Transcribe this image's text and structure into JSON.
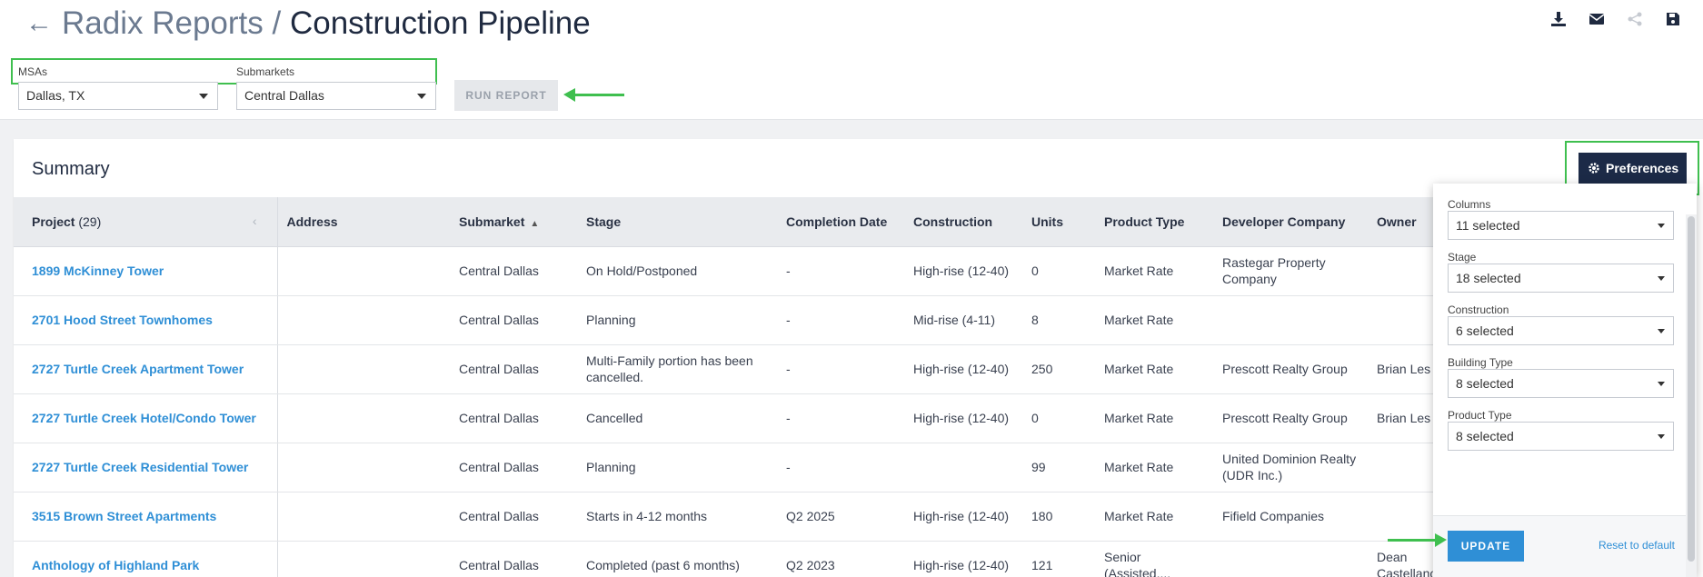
{
  "header": {
    "crumb": "Radix Reports",
    "separator": " / ",
    "title": "Construction Pipeline",
    "icons": [
      "download-icon",
      "email-icon",
      "share-icon",
      "save-icon"
    ]
  },
  "filters": {
    "msa_label": "MSAs",
    "msa_value": "Dallas, TX",
    "submarket_label": "Submarkets",
    "submarket_value": "Central Dallas",
    "run_label": "RUN REPORT"
  },
  "summary": {
    "title": "Summary",
    "preferences_label": "Preferences",
    "columns": [
      {
        "label": "Project",
        "count": "(29)"
      },
      {
        "label": "Address"
      },
      {
        "label": "Submarket"
      },
      {
        "label": "Stage"
      },
      {
        "label": "Completion Date"
      },
      {
        "label": "Construction"
      },
      {
        "label": "Units"
      },
      {
        "label": "Product Type"
      },
      {
        "label": "Developer Company"
      },
      {
        "label": "Owner"
      }
    ],
    "rows": [
      {
        "project": "1899 McKinney Tower",
        "address": "",
        "submarket": "Central Dallas",
        "stage": "On Hold/Postponed",
        "completion": "-",
        "construction": "High-rise (12-40)",
        "units": "0",
        "product": "Market Rate",
        "developer": "Rastegar Property Company",
        "owner": ""
      },
      {
        "project": "2701 Hood Street Townhomes",
        "address": "",
        "submarket": "Central Dallas",
        "stage": "Planning",
        "completion": "-",
        "construction": "Mid-rise (4-11)",
        "units": "8",
        "product": "Market Rate",
        "developer": "",
        "owner": ""
      },
      {
        "project": "2727 Turtle Creek Apartment Tower",
        "address": "",
        "submarket": "Central Dallas",
        "stage": "Multi-Family portion has been cancelled.",
        "completion": "-",
        "construction": "High-rise (12-40)",
        "units": "250",
        "product": "Market Rate",
        "developer": "Prescott Realty Group",
        "owner": "Brian Les"
      },
      {
        "project": "2727 Turtle Creek Hotel/Condo Tower",
        "address": "",
        "submarket": "Central Dallas",
        "stage": "Cancelled",
        "completion": "-",
        "construction": "High-rise (12-40)",
        "units": "0",
        "product": "Market Rate",
        "developer": "Prescott Realty Group",
        "owner": "Brian Les"
      },
      {
        "project": "2727 Turtle Creek Residential Tower",
        "address": "",
        "submarket": "Central Dallas",
        "stage": "Planning",
        "completion": "-",
        "construction": "",
        "units": "99",
        "product": "Market Rate",
        "developer": "United Dominion Realty (UDR Inc.)",
        "owner": ""
      },
      {
        "project": "3515 Brown Street Apartments",
        "address": "",
        "submarket": "Central Dallas",
        "stage": "Starts in 4-12 months",
        "completion": "Q2 2025",
        "construction": "High-rise (12-40)",
        "units": "180",
        "product": "Market Rate",
        "developer": "Fifield Companies",
        "owner": ""
      },
      {
        "project": "Anthology of Highland Park",
        "address": "",
        "submarket": "Central Dallas",
        "stage": "Completed (past 6 months)",
        "completion": "Q2 2023",
        "construction": "High-rise (12-40)",
        "units": "121",
        "product": "Senior (Assisted,...",
        "developer": "",
        "owner": "Dean Castellano"
      }
    ]
  },
  "preferences_panel": {
    "fields": [
      {
        "label": "Columns",
        "value": "11 selected"
      },
      {
        "label": "Stage",
        "value": "18 selected"
      },
      {
        "label": "Construction",
        "value": "6 selected"
      },
      {
        "label": "Building Type",
        "value": "8 selected"
      },
      {
        "label": "Product Type",
        "value": "8 selected"
      }
    ],
    "update_label": "UPDATE",
    "reset_label": "Reset to default"
  },
  "colors": {
    "accent_green": "#3fbf4f",
    "link_blue": "#2f8fd6",
    "navy": "#1c2a47"
  }
}
